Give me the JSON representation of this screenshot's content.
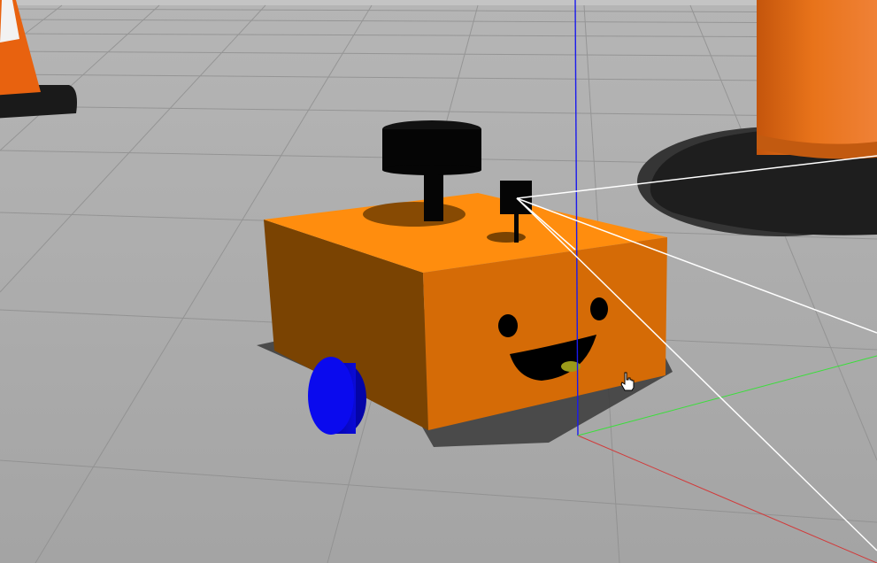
{
  "viewport": {
    "background_color": "#a9a9a9",
    "sky_color": "#c4c4c4",
    "grid_color": "#8f8f8f"
  },
  "robot": {
    "body_color": "#ff8a0a",
    "front_face_color": "#d56b06",
    "side_face_color": "#7a4302",
    "top_face_color": "#ff8d0e",
    "wheel_color": "#0a0aee",
    "wheel_side_color": "#0404a8",
    "lidar_color": "#050505",
    "camera_color": "#050505",
    "face_features_color": "#000000",
    "tongue_color": "#9a9a1a"
  },
  "obstacles": {
    "cone_color": "#e8620f",
    "cone_stripe_color": "#f2f2f2",
    "cone_base_color": "#1a1a1a",
    "barrel_color": "#e26a12"
  },
  "axes": {
    "z_axis_color": "#1a1aee",
    "x_axis_color": "#d23a3a",
    "y_axis_color": "#3adf3a"
  },
  "sensor": {
    "ray_color": "#ffffff"
  },
  "cursor": {
    "icon": "hand-pointer-icon"
  }
}
